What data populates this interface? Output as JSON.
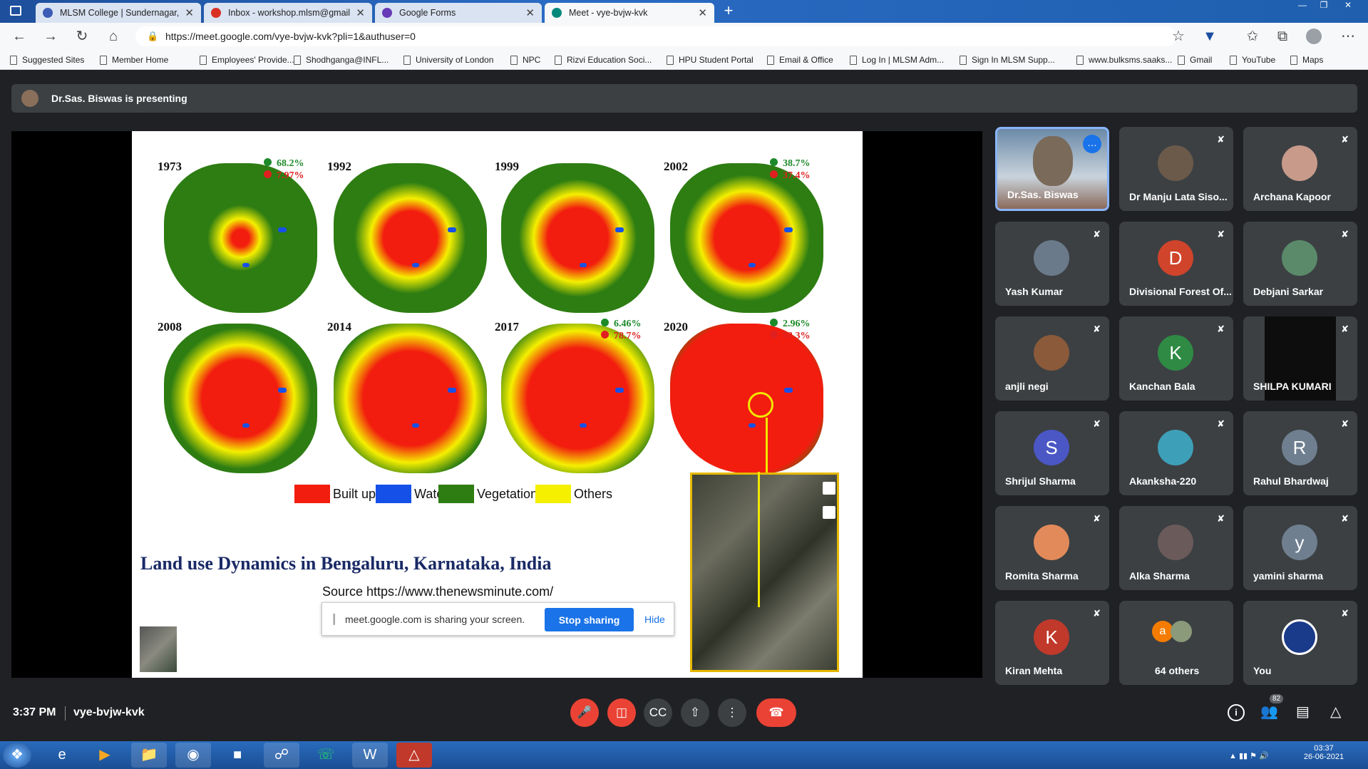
{
  "browser": {
    "tabs": [
      {
        "label": "MLSM College | Sundernagar, M",
        "icon": "college-favicon",
        "color": "#3b5bb5"
      },
      {
        "label": "Inbox - workshop.mlsm@gmail.c",
        "icon": "gmail-favicon",
        "color": "#d93025"
      },
      {
        "label": "Google Forms",
        "icon": "forms-favicon",
        "color": "#673ab7"
      },
      {
        "label": "Meet - vye-bvjw-kvk",
        "icon": "meet-favicon",
        "color": "#00897b"
      }
    ],
    "url": "https://meet.google.com/vye-bvjw-kvk?pli=1&authuser=0",
    "bookmarks": [
      "Suggested Sites",
      "Member Home",
      "Employees' Provide...",
      "Shodhganga@INFL...",
      "University of London",
      "NPC",
      "Rizvi Education Soci...",
      "HPU Student Portal",
      "Email & Office",
      "Log In | MLSM Adm...",
      "Sign In MLSM Supp...",
      "www.bulksms.saaks...",
      "Gmail",
      "YouTube",
      "Maps"
    ]
  },
  "meet": {
    "presenting": "Dr.Sas. Biswas is presenting",
    "time": "3:37 PM",
    "code": "vye-bvjw-kvk",
    "people_count": "82"
  },
  "slide": {
    "title": "Land use Dynamics in Bengaluru, Karnataka, India",
    "source": "Source https://www.thenewsminute.com/",
    "maps": [
      {
        "year": "1973",
        "veg": "68.2%",
        "built": "7.97%",
        "level": 0.15
      },
      {
        "year": "1992",
        "veg": "",
        "built": "",
        "level": 0.45
      },
      {
        "year": "1999",
        "veg": "",
        "built": "",
        "level": 0.5
      },
      {
        "year": "2002",
        "veg": "38.7%",
        "built": "37.4%",
        "level": 0.55
      },
      {
        "year": "2008",
        "veg": "",
        "built": "",
        "level": 0.65
      },
      {
        "year": "2014",
        "veg": "",
        "built": "",
        "level": 0.8
      },
      {
        "year": "2017",
        "veg": "6.46%",
        "built": "78.7%",
        "level": 0.85
      },
      {
        "year": "2020",
        "veg": "2.96%",
        "built": "93.3%",
        "level": 0.97
      }
    ],
    "legend": [
      {
        "label": "Built up",
        "color": "#f21d0e"
      },
      {
        "label": "Water",
        "color": "#1550e8"
      },
      {
        "label": "Vegetation",
        "color": "#2d7d12"
      },
      {
        "label": "Others",
        "color": "#f5ef00"
      }
    ]
  },
  "share": {
    "text": "meet.google.com is sharing your screen.",
    "stop": "Stop sharing",
    "hide": "Hide"
  },
  "participants": [
    {
      "name": "Dr.Sas. Biswas",
      "type": "video",
      "initial": "",
      "color": "#7a6a5a"
    },
    {
      "name": "Dr Manju Lata Siso...",
      "type": "photo",
      "initial": "",
      "color": "#6b5a4a"
    },
    {
      "name": "Archana Kapoor",
      "type": "photo",
      "initial": "",
      "color": "#c79a8a"
    },
    {
      "name": "Yash Kumar",
      "type": "photo",
      "initial": "",
      "color": "#6a7a8a"
    },
    {
      "name": "Divisional Forest Of...",
      "type": "letter",
      "initial": "D",
      "color": "#d0442b"
    },
    {
      "name": "Debjani Sarkar",
      "type": "photo",
      "initial": "",
      "color": "#5a8a6a"
    },
    {
      "name": "anjli negi",
      "type": "photo",
      "initial": "",
      "color": "#8a5a3a"
    },
    {
      "name": "Kanchan Bala",
      "type": "letter",
      "initial": "K",
      "color": "#2f8a44"
    },
    {
      "name": "SHILPA KUMARI",
      "type": "dark",
      "initial": "",
      "color": "#0d0d0d"
    },
    {
      "name": "Shrijul Sharma",
      "type": "letter",
      "initial": "S",
      "color": "#4a57c4"
    },
    {
      "name": "Akanksha-220",
      "type": "photo",
      "initial": "",
      "color": "#3ea0b8"
    },
    {
      "name": "Rahul Bhardwaj",
      "type": "letter",
      "initial": "R",
      "color": "#6f7f8f"
    },
    {
      "name": "Romita Sharma",
      "type": "photo",
      "initial": "",
      "color": "#e38a5a"
    },
    {
      "name": "Alka Sharma",
      "type": "photo",
      "initial": "",
      "color": "#6a5a5a"
    },
    {
      "name": "yamini sharma",
      "type": "letter",
      "initial": "y",
      "color": "#6f7f8f"
    },
    {
      "name": "Kiran Mehta",
      "type": "letter",
      "initial": "K",
      "color": "#c0392b"
    },
    {
      "name": "64 others",
      "type": "others",
      "initial": "a",
      "color": "#f57c00"
    },
    {
      "name": "You",
      "type": "emblem",
      "initial": "",
      "color": "#1a3a8a"
    }
  ],
  "taskbar": {
    "time": "03:37",
    "date": "26-06-2021"
  }
}
